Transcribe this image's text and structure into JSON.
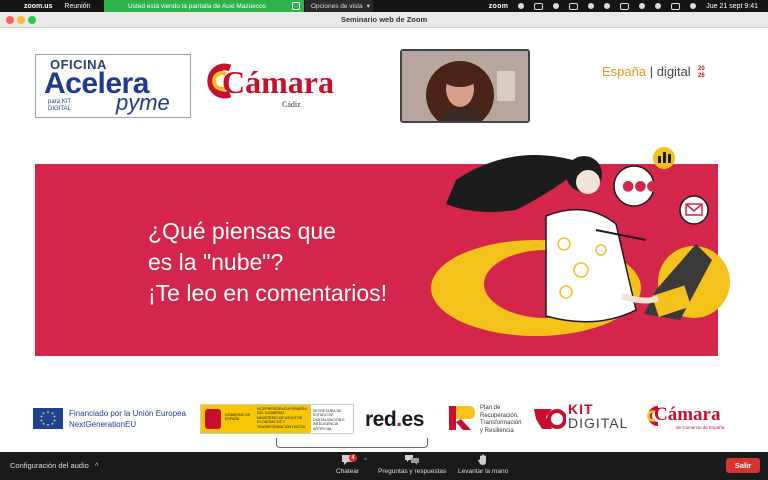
{
  "menubar": {
    "app_name": "zoom.us",
    "menu_item": "Reunión",
    "share_status": "Usted está viendo la pantalla de Auxi Mazuecos",
    "view_options": "Opciones de vista",
    "zoom_label": "zoom",
    "datetime": "Jue 21 sept  9:41"
  },
  "window": {
    "title": "Seminario web de Zoom"
  },
  "slide": {
    "acelera": {
      "oficina": "OFICINA",
      "main": "Acelera",
      "pyme": "pyme",
      "kit_para": "para",
      "kit_line1": "KIT",
      "kit_line2": "DIGITAL"
    },
    "camara_top": {
      "word": "Cámara",
      "city": "Cádiz"
    },
    "espana": {
      "espana": "España",
      "sep": " | ",
      "digital": "digital",
      "year_a": "20",
      "year_b": "26"
    },
    "banner": {
      "line1": "¿Qué piensas que",
      "line2": "es la \"nube\"?",
      "line3": "¡Te leo en comentarios!"
    },
    "footer": {
      "eu_line1": "Financiado por la Unión Europea",
      "eu_line2": "NextGenerationEU",
      "gob_gobierno": "GOBIERNO DE ESPAÑA",
      "gob_vice": "VICEPRESIDENCIA PRIMERA DEL GOBIERNO",
      "gob_min": "MINISTERIO DE ASUNTOS ECONÓMICOS Y TRANSFORMACIÓN DIGITAL",
      "gob_sec": "SECRETARÍA DE ESTADO DE DIGITALIZACIÓN E INTELIGENCIA ARTIFICIAL",
      "redes_a": "red",
      "redes_dot": ".",
      "redes_b": "es",
      "plan_l1": "Plan de",
      "plan_l2": "Recuperación,",
      "plan_l3": "Transformación",
      "plan_l4": "y Resiliencia",
      "kit_l1": "KIT",
      "kit_l2": "DIGITAL",
      "camara_word": "Cámara",
      "camara_sub": "de Comercio de España"
    }
  },
  "toolbar": {
    "audio_config": "Configuración del audio",
    "chat_label": "Chatear",
    "chat_badge": "4",
    "qa_label": "Preguntas y respuestas",
    "raise_label": "Levantar la mano",
    "leave_label": "Salir"
  },
  "colors": {
    "banner_red": "#d3264a",
    "accent_yellow": "#f5c21b",
    "leave_red": "#d8342f",
    "share_green": "#2fb24a"
  }
}
